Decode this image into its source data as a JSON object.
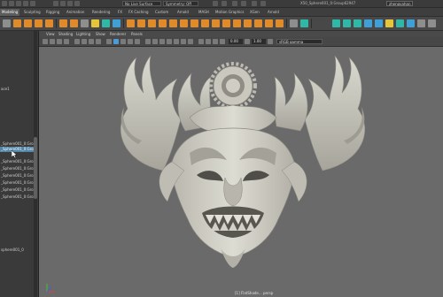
{
  "status_bar": {
    "live_surface": "No Live Surface",
    "symmetry": "Symmetry: Off",
    "file_label": "X50_Sphere001_0:Group62947",
    "user": "zhengyahan"
  },
  "shelf_tabs": [
    {
      "label": "Modeling",
      "active": true
    },
    {
      "label": "Sculpting",
      "active": false
    },
    {
      "label": "Rigging",
      "active": false
    },
    {
      "label": "Animation",
      "active": false
    },
    {
      "label": "Rendering",
      "active": false
    },
    {
      "label": "FX",
      "active": false
    },
    {
      "label": "FX Caching",
      "active": false
    },
    {
      "label": "Custom",
      "active": false
    },
    {
      "label": "Arnold",
      "active": false
    },
    {
      "label": "MASH",
      "active": false
    },
    {
      "label": "Motion Graphics",
      "active": false
    },
    {
      "label": "XGen",
      "active": false
    },
    {
      "label": "Arnold",
      "active": false
    }
  ],
  "viewport_menu": [
    "View",
    "Shading",
    "Lighting",
    "Show",
    "Renderer",
    "Panels"
  ],
  "viewport_tools": {
    "near_value": "0.00",
    "far_value": "1.00",
    "color_space": "sRGB gamma"
  },
  "outliner": {
    "items": [
      {
        "label": "ace1",
        "selected": false
      },
      {
        "label": "_Sphere001_0:Grou",
        "selected": false
      },
      {
        "label": "_Sphere001_0:Grou",
        "selected": true
      },
      {
        "label": "_Sphere001_0:Grou",
        "selected": false
      },
      {
        "label": "_Sphere001_0:Grou",
        "selected": false
      },
      {
        "label": "_Sphere001_0:Grou",
        "selected": false
      },
      {
        "label": "_Sphere001_0:Grou",
        "selected": false
      },
      {
        "label": "_Sphere001_0:Grou",
        "selected": false
      },
      {
        "label": "_Sphere001_0:Grou",
        "selected": false
      },
      {
        "label": "sphere001_0",
        "selected": false
      }
    ]
  },
  "viewport": {
    "camera_label": "[1] FlatShade... persp",
    "model": "demon-mask-sculpt"
  }
}
